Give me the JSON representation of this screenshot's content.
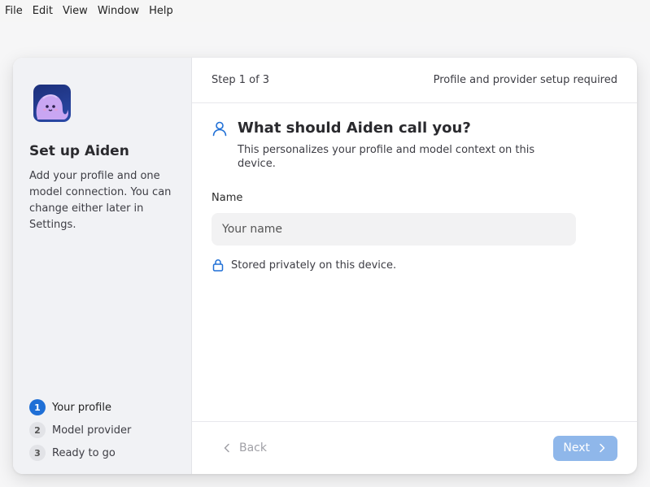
{
  "menubar": {
    "items": [
      "File",
      "Edit",
      "View",
      "Window",
      "Help"
    ]
  },
  "sidebar": {
    "logo_icon": "ghost-mascot-icon",
    "title": "Set up Aiden",
    "description": "Add your profile and one model connection. You can change either later in Settings.",
    "steps": [
      {
        "number": "1",
        "label": "Your profile",
        "active": true
      },
      {
        "number": "2",
        "label": "Model provider",
        "active": false
      },
      {
        "number": "3",
        "label": "Ready to go",
        "active": false
      }
    ]
  },
  "header": {
    "step_text": "Step 1 of 3",
    "status_text": "Profile and provider setup required"
  },
  "content": {
    "question_icon": "user-icon",
    "question": "What should Aiden call you?",
    "subtitle": "This personalizes your profile and model context on this device.",
    "name_label": "Name",
    "name_value": "",
    "name_placeholder": "Your name",
    "privacy_icon": "lock-icon",
    "privacy_text": "Stored privately on this device."
  },
  "footer": {
    "back_label": "Back",
    "next_label": "Next"
  },
  "colors": {
    "accent": "#1f6fd6",
    "next_button_disabled": "#8fb7ea",
    "logo_background": "#1c2f7a",
    "sidebar_background": "#f1f2f5"
  }
}
